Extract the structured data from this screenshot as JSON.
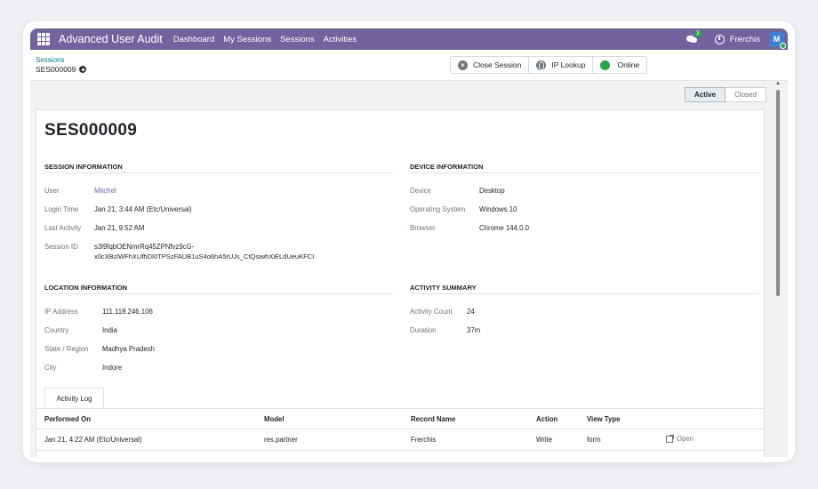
{
  "navbar": {
    "brand": "Advanced User Audit",
    "menu": [
      "Dashboard",
      "My Sessions",
      "Sessions",
      "Activities"
    ],
    "chat_badge": "3",
    "company": "Frerchis",
    "avatar_initial": "M",
    "accent": "#71639e"
  },
  "breadcrumb": {
    "parent": "Sessions",
    "current": "SES000009"
  },
  "smart_buttons": {
    "close_session": "Close Session",
    "ip_lookup": "IP Lookup",
    "online": "Online"
  },
  "statusbar": {
    "active": "Active",
    "closed": "Closed"
  },
  "record": {
    "title": "SES000009",
    "session_info": {
      "heading": "SESSION INFORMATION",
      "user_label": "User",
      "user": "Mitchel",
      "login_label": "Login Time",
      "login": "Jan 21, 3:44 AM (Etc/Universal)",
      "last_label": "Last Activity",
      "last": "Jan 21, 9:52 AM",
      "sid_label": "Session ID",
      "sid_line1": "s3l9fqbOENmrRq45ZPNfvz9cG-",
      "sid_line2": "x0cXBzlWFhXUfhDI0TPSzFAUB1uS4o6hA5rUJs_CtQsiwhXiELdUeuKFCI"
    },
    "device_info": {
      "heading": "DEVICE INFORMATION",
      "device_label": "Device",
      "device": "Desktop",
      "os_label": "Operating System",
      "os": "Windows 10",
      "browser_label": "Browser",
      "browser": "Chrome 144.0.0"
    },
    "location_info": {
      "heading": "LOCATION INFORMATION",
      "ip_label": "IP Address",
      "ip": "111.118.246.106",
      "country_label": "Country",
      "country": "India",
      "state_label": "State / Region",
      "state": "Madhya Pradesh",
      "city_label": "City",
      "city": "Indore"
    },
    "activity_summary": {
      "heading": "ACTIVITY SUMMARY",
      "count_label": "Activity Count",
      "count": "24",
      "duration_label": "Duration",
      "duration": "37m"
    }
  },
  "activity_log": {
    "tab": "Activity Log",
    "columns": [
      "Performed On",
      "Model",
      "Record Name",
      "Action",
      "View Type"
    ],
    "rows": [
      {
        "performed_on": "Jan 21, 4:22 AM (Etc/Universal)",
        "model": "res.partner",
        "record_name": "Frerchis",
        "action": "Write",
        "view_type": "form",
        "open": "Open"
      }
    ]
  }
}
